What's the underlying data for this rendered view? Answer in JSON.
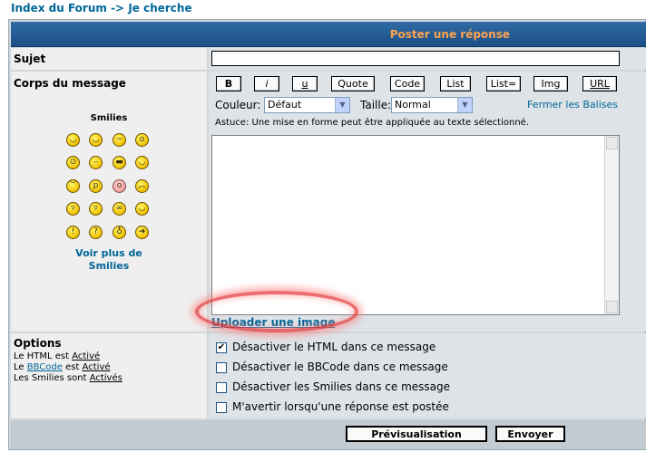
{
  "breadcrumb": {
    "forum_index": "Index du Forum",
    "separator": "->",
    "topic": "Je cherche"
  },
  "header": {
    "title": "Poster une réponse"
  },
  "subject": {
    "label": "Sujet",
    "value": ""
  },
  "body": {
    "label": "Corps du message",
    "smilies_title": "Smilies",
    "more_smilies_line1": "Voir plus de",
    "more_smilies_line2": "Smilies"
  },
  "bbcode": {
    "buttons": [
      "B",
      "i",
      "u",
      "Quote",
      "Code",
      "List",
      "List=",
      "Img",
      "URL"
    ],
    "color_label": "Couleur:",
    "color_value": "Défaut",
    "size_label": "Taille:",
    "size_value": "Normal",
    "close_tags": "Fermer les Balises",
    "tip": "Astuce: Une mise en forme peut être appliquée au texte sélectionné."
  },
  "message": {
    "value": ""
  },
  "upload": {
    "label": "Uploader une image"
  },
  "options": {
    "title": "Options",
    "html_prefix": "Le HTML est",
    "html_state": "Activé",
    "bbcode_prefix": "Le",
    "bbcode_link": "BBCode",
    "bbcode_mid": "est",
    "bbcode_state": "Activé",
    "smilies_prefix": "Les Smilies sont",
    "smilies_state": "Activés",
    "checks": [
      {
        "label": "Désactiver le HTML dans ce message",
        "checked": true
      },
      {
        "label": "Désactiver le BBCode dans ce message",
        "checked": false
      },
      {
        "label": "Désactiver les Smilies dans ce message",
        "checked": false
      },
      {
        "label": "M'avertir lorsqu'une réponse est postée",
        "checked": false
      }
    ]
  },
  "actions": {
    "preview": "Prévisualisation",
    "send": "Envoyer"
  },
  "colors": {
    "accent": "#006699",
    "header_text": "#ffa34f",
    "highlight": "#e63c3c"
  }
}
